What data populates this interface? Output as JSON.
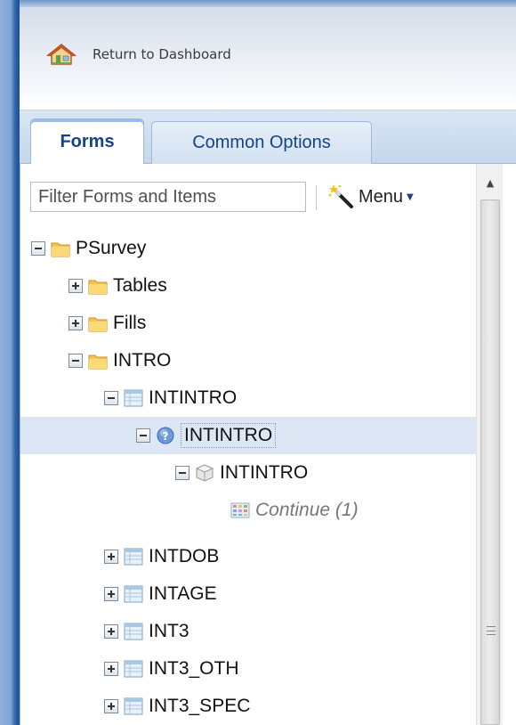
{
  "header": {
    "return_label": "Return to Dashboard"
  },
  "tabs": [
    {
      "label": "Forms",
      "active": true
    },
    {
      "label": "Common Options",
      "active": false
    }
  ],
  "toolbar": {
    "filter_placeholder": "Filter Forms and Items",
    "menu_label": "Menu"
  },
  "tree": [
    {
      "label": "PSurvey",
      "icon": "folder-icon",
      "expanded": true
    },
    {
      "label": "Tables",
      "icon": "folder-icon",
      "expanded": false
    },
    {
      "label": "Fills",
      "icon": "folder-icon",
      "expanded": false
    },
    {
      "label": "INTRO",
      "icon": "folder-icon",
      "expanded": true
    },
    {
      "label": "INTINTRO",
      "icon": "form-icon",
      "expanded": true
    },
    {
      "label": "INTINTRO",
      "icon": "question-icon",
      "expanded": true,
      "selected": true
    },
    {
      "label": "INTINTRO",
      "icon": "cube-icon",
      "expanded": true
    },
    {
      "label": "Continue (1)",
      "icon": "grid-icon"
    },
    {
      "label": "INTDOB",
      "icon": "form-icon",
      "expanded": false
    },
    {
      "label": "INTAGE",
      "icon": "form-icon",
      "expanded": false
    },
    {
      "label": "INT3",
      "icon": "form-icon",
      "expanded": false
    },
    {
      "label": "INT3_OTH",
      "icon": "form-icon",
      "expanded": false
    },
    {
      "label": "INT3_SPEC",
      "icon": "form-icon",
      "expanded": false
    }
  ],
  "colors": {
    "accent": "#15428b",
    "selection": "#dce6f4",
    "frame_blue": "#1c4f95"
  }
}
